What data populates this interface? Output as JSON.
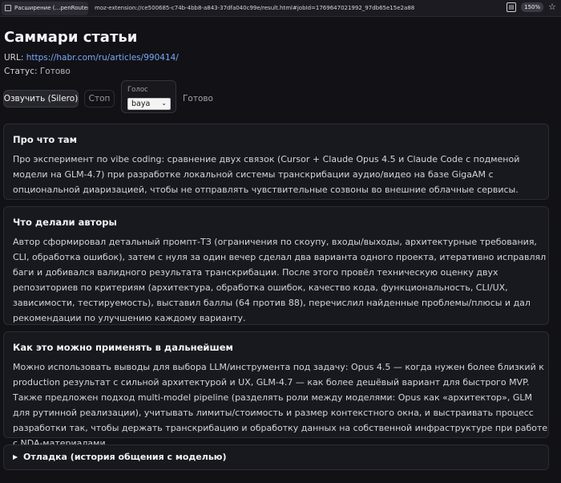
{
  "browser": {
    "tab_title": "Расширение (…penRouter))",
    "url": "moz-extension://ce500685-c74b-4bb8-a843-37dfa040c99e/result.html#jobId=1769647021992_97db65e15e2a88",
    "zoom": "150%"
  },
  "page": {
    "title": "Саммари статьи",
    "url_label": "URL:",
    "url_link": "https://habr.com/ru/articles/990414/",
    "status_label": "Статус:",
    "status_value": "Готово"
  },
  "controls": {
    "speak_button": "Озвучить (Silero)",
    "stop_button": "Стоп",
    "voice_label": "Голос",
    "voice_selected": "baya",
    "tts_status": "Готово"
  },
  "sections": [
    {
      "title": "Про что там",
      "text": "Про эксперимент по vibe coding: сравнение двух связок (Cursor + Claude Opus 4.5 и Claude Code с подменой модели на GLM-4.7) при разработке локальной системы транскрибации аудио/видео на базе GigaAM с опциональной диаризацией, чтобы не отправлять чувствительные созвоны во внешние облачные сервисы."
    },
    {
      "title": "Что делали авторы",
      "text": "Автор сформировал детальный промпт-ТЗ (ограничения по скоупу, входы/выходы, архитектурные требования, CLI, обработка ошибок), затем с нуля за один вечер сделал два варианта одного проекта, итеративно исправлял баги и добивался валидного результата транскрибации. После этого провёл техническую оценку двух репозиториев по критериям (архитектура, обработка ошибок, качество кода, функциональность, CLI/UX, зависимости, тестируемость), выставил баллы (64 против 88), перечислил найденные проблемы/плюсы и дал рекомендации по улучшению каждому варианту."
    },
    {
      "title": "Как это можно применять в дальнейшем",
      "text": "Можно использовать выводы для выбора LLM/инструмента под задачу: Opus 4.5 — когда нужен более близкий к production результат с сильной архитектурой и UX, GLM-4.7 — как более дешёвый вариант для быстрого MVP. Также предложен подход multi-model pipeline (разделять роли между моделями: Opus как «архитектор», GLM для рутинной реализации), учитывать лимиты/стоимость и размер контекстного окна, и выстраивать процесс разработки так, чтобы держать транскрибацию и обработку данных на собственной инфраструктуре при работе с NDA-материалами."
    }
  ],
  "debug": {
    "label": "Отладка (история общения с моделью)"
  }
}
